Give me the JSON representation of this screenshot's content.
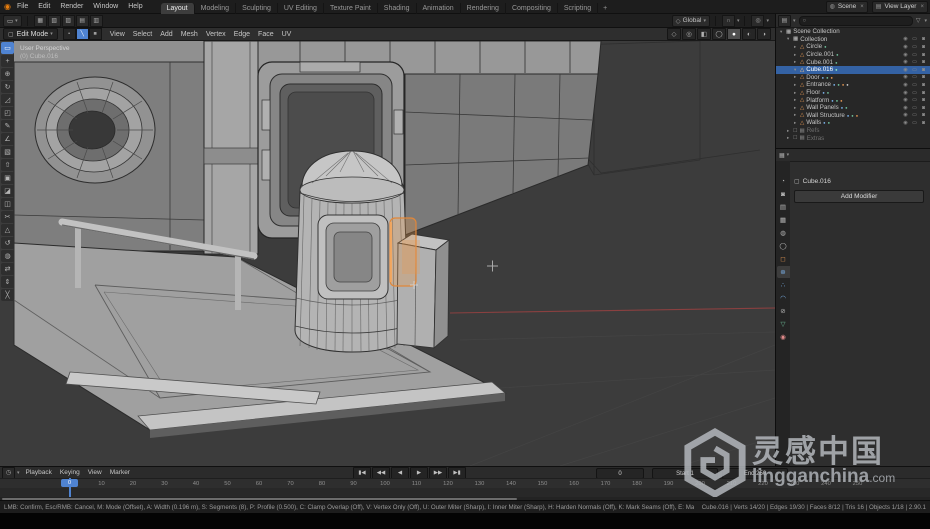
{
  "icons": {
    "dropdown": "▾",
    "close": "×",
    "search": "○",
    "funnel": "▽",
    "magnet": "∩",
    "proportional": "◎",
    "orientation": "◇",
    "eye": "◉",
    "monitor": "▭",
    "camera": "◙",
    "checkbox": "☐",
    "cube": "▢",
    "clock": "◷",
    "active_tool": "▭",
    "editor_outliner": "▤",
    "editor_properties": "▦"
  },
  "topbar": {
    "menus": [
      "File",
      "Edit",
      "Render",
      "Window",
      "Help"
    ],
    "tabs": [
      {
        "label": "Layout",
        "active": true
      },
      {
        "label": "Modeling",
        "active": false
      },
      {
        "label": "Sculpting",
        "active": false
      },
      {
        "label": "UV Editing",
        "active": false
      },
      {
        "label": "Texture Paint",
        "active": false
      },
      {
        "label": "Shading",
        "active": false
      },
      {
        "label": "Animation",
        "active": false
      },
      {
        "label": "Rendering",
        "active": false
      },
      {
        "label": "Compositing",
        "active": false
      },
      {
        "label": "Scripting",
        "active": false
      }
    ],
    "new_tab_label": "+",
    "scene_label": "Scene",
    "view_layer_label": "View Layer"
  },
  "toolrow": {
    "buttons": [
      "▦",
      "▧",
      "▨",
      "▤",
      "▥"
    ],
    "orientation_label": "Global"
  },
  "viewport_header": {
    "mode_label": "Edit Mode",
    "select_modes": [
      {
        "name": "vertex",
        "glyph": "▪",
        "active": false
      },
      {
        "name": "edge",
        "glyph": "╲",
        "active": true
      },
      {
        "name": "face",
        "glyph": "■",
        "active": false
      }
    ],
    "menus": [
      "View",
      "Select",
      "Add",
      "Mesh",
      "Vertex",
      "Edge",
      "Face",
      "UV"
    ],
    "right_icons": [
      {
        "name": "show-gizmos",
        "glyph": "◇",
        "active": false
      },
      {
        "name": "show-overlays",
        "glyph": "◎",
        "active": false
      },
      {
        "name": "toggle-xray",
        "glyph": "◧",
        "active": false
      },
      {
        "name": "shading-wireframe",
        "glyph": "◯",
        "active": false
      },
      {
        "name": "shading-solid",
        "glyph": "●",
        "active": true
      },
      {
        "name": "shading-material",
        "glyph": "◐",
        "active": false
      },
      {
        "name": "shading-rendered",
        "glyph": "◑",
        "active": false
      }
    ]
  },
  "viewport": {
    "overlay_line1": "User Perspective",
    "overlay_line2": "(0) Cube.016",
    "x_axis_color": "#8a4040",
    "selection_highlight_color": "#e0873a"
  },
  "toolbar": {
    "tools": [
      {
        "name": "select-box",
        "glyph": "▭",
        "active": true
      },
      {
        "name": "cursor",
        "glyph": "+",
        "active": false
      },
      {
        "name": "move",
        "glyph": "⊕",
        "active": false
      },
      {
        "name": "rotate",
        "glyph": "↻",
        "active": false
      },
      {
        "name": "scale",
        "glyph": "◿",
        "active": false
      },
      {
        "name": "transform",
        "glyph": "◰",
        "active": false
      },
      {
        "name": "annotate",
        "glyph": "✎",
        "active": false
      },
      {
        "name": "measure",
        "glyph": "∠",
        "active": false
      },
      {
        "name": "add-cube",
        "glyph": "▧",
        "active": false
      },
      {
        "name": "extrude-region",
        "glyph": "⇧",
        "active": false
      },
      {
        "name": "inset-faces",
        "glyph": "▣",
        "active": false
      },
      {
        "name": "bevel",
        "glyph": "◪",
        "active": false
      },
      {
        "name": "loop-cut",
        "glyph": "◫",
        "active": false
      },
      {
        "name": "knife",
        "glyph": "✂",
        "active": false
      },
      {
        "name": "poly-build",
        "glyph": "△",
        "active": false
      },
      {
        "name": "spin",
        "glyph": "↺",
        "active": false
      },
      {
        "name": "smooth",
        "glyph": "◍",
        "active": false
      },
      {
        "name": "edge-slide",
        "glyph": "⇄",
        "active": false
      },
      {
        "name": "shrink-fatten",
        "glyph": "⇕",
        "active": false
      },
      {
        "name": "rip-region",
        "glyph": "╳",
        "active": false
      }
    ]
  },
  "outliner": {
    "search_value": "",
    "items": [
      {
        "label": "Scene Collection",
        "level": 0,
        "arrow": "▾",
        "glyph": "▦",
        "color": "#c9c9c9",
        "icon": "scene-collection",
        "badges": [],
        "toggles": false,
        "selected": false,
        "dim": false,
        "checkbox": false
      },
      {
        "label": "Collection",
        "level": 1,
        "arrow": "▾",
        "glyph": "▦",
        "color": "#c9c9c9",
        "icon": "collection",
        "badges": [],
        "toggles": true,
        "selected": false,
        "dim": false,
        "checkbox": false
      },
      {
        "label": "Circle",
        "level": 2,
        "arrow": "▸",
        "glyph": "△",
        "color": "#e09553",
        "icon": "mesh-object",
        "badges": [
          "#6fbf9a"
        ],
        "toggles": true,
        "selected": false,
        "dim": false,
        "checkbox": false
      },
      {
        "label": "Circle.001",
        "level": 2,
        "arrow": "▸",
        "glyph": "△",
        "color": "#e09553",
        "icon": "mesh-object",
        "badges": [
          "#6fbf9a"
        ],
        "toggles": true,
        "selected": false,
        "dim": false,
        "checkbox": false
      },
      {
        "label": "Cube.001",
        "level": 2,
        "arrow": "▸",
        "glyph": "△",
        "color": "#e09553",
        "icon": "mesh-object",
        "badges": [
          "#6fbf9a"
        ],
        "toggles": true,
        "selected": false,
        "dim": false,
        "checkbox": false
      },
      {
        "label": "Cube.016",
        "level": 2,
        "arrow": "▾",
        "glyph": "△",
        "color": "#ffc98c",
        "icon": "mesh-object",
        "badges": [
          "#8fe8c2"
        ],
        "toggles": true,
        "selected": true,
        "dim": false,
        "checkbox": false
      },
      {
        "label": "Door",
        "level": 2,
        "arrow": "▸",
        "glyph": "△",
        "color": "#e09553",
        "icon": "mesh-object",
        "badges": [
          "#7ab0e8",
          "#6fbf9a",
          "#e09553"
        ],
        "toggles": true,
        "selected": false,
        "dim": false,
        "checkbox": false
      },
      {
        "label": "Entrance",
        "level": 2,
        "arrow": "▸",
        "glyph": "△",
        "color": "#e09553",
        "icon": "mesh-object",
        "badges": [
          "#7ab0e8",
          "#6fbf9a",
          "#e09553",
          "#c9c9c9"
        ],
        "toggles": true,
        "selected": false,
        "dim": false,
        "checkbox": false
      },
      {
        "label": "Floor",
        "level": 2,
        "arrow": "▸",
        "glyph": "△",
        "color": "#e09553",
        "icon": "mesh-object",
        "badges": [
          "#7ab0e8",
          "#6fbf9a"
        ],
        "toggles": true,
        "selected": false,
        "dim": false,
        "checkbox": false
      },
      {
        "label": "Platform",
        "level": 2,
        "arrow": "▸",
        "glyph": "△",
        "color": "#e09553",
        "icon": "mesh-object",
        "badges": [
          "#7ab0e8",
          "#6fbf9a",
          "#e09553"
        ],
        "toggles": true,
        "selected": false,
        "dim": false,
        "checkbox": false
      },
      {
        "label": "Wall Panels",
        "level": 2,
        "arrow": "▸",
        "glyph": "△",
        "color": "#e09553",
        "icon": "mesh-object",
        "badges": [
          "#7ab0e8",
          "#6fbf9a"
        ],
        "toggles": true,
        "selected": false,
        "dim": false,
        "checkbox": false
      },
      {
        "label": "Wall Structure",
        "level": 2,
        "arrow": "▸",
        "glyph": "△",
        "color": "#e09553",
        "icon": "mesh-object",
        "badges": [
          "#7ab0e8",
          "#6fbf9a",
          "#e09553"
        ],
        "toggles": true,
        "selected": false,
        "dim": false,
        "checkbox": false
      },
      {
        "label": "Walls",
        "level": 2,
        "arrow": "▸",
        "glyph": "△",
        "color": "#e09553",
        "icon": "mesh-object",
        "badges": [
          "#7ab0e8",
          "#6fbf9a"
        ],
        "toggles": true,
        "selected": false,
        "dim": false,
        "checkbox": false
      },
      {
        "label": "Refs",
        "level": 1,
        "arrow": "▸",
        "glyph": "▦",
        "color": "#7a7a7a",
        "icon": "collection",
        "badges": [],
        "toggles": false,
        "selected": false,
        "dim": true,
        "checkbox": true
      },
      {
        "label": "Extras",
        "level": 1,
        "arrow": "▸",
        "glyph": "▦",
        "color": "#7a7a7a",
        "icon": "collection",
        "badges": [],
        "toggles": false,
        "selected": false,
        "dim": true,
        "checkbox": true
      }
    ]
  },
  "properties": {
    "tabs": [
      {
        "name": "tool",
        "glyph": "◔",
        "color": "#b8b8b8",
        "active": false
      },
      {
        "name": "render",
        "glyph": "◙",
        "color": "#b8b8b8",
        "active": false
      },
      {
        "name": "output",
        "glyph": "▤",
        "color": "#b8b8b8",
        "active": false
      },
      {
        "name": "view-layer",
        "glyph": "▦",
        "color": "#b8b8b8",
        "active": false
      },
      {
        "name": "scene",
        "glyph": "◍",
        "color": "#b8b8b8",
        "active": false
      },
      {
        "name": "world",
        "glyph": "◯",
        "color": "#b8b8b8",
        "active": false
      },
      {
        "name": "object",
        "glyph": "◻",
        "color": "#e09553",
        "active": false
      },
      {
        "name": "modifiers",
        "glyph": "⊛",
        "color": "#7ab0e8",
        "active": true
      },
      {
        "name": "particles",
        "glyph": "∴",
        "color": "#7ab0e8",
        "active": false
      },
      {
        "name": "physics",
        "glyph": "◠",
        "color": "#7ab0e8",
        "active": false
      },
      {
        "name": "constraints",
        "glyph": "⊘",
        "color": "#b8b8b8",
        "active": false
      },
      {
        "name": "object-data",
        "glyph": "▽",
        "color": "#6fbf9a",
        "active": false
      },
      {
        "name": "material",
        "glyph": "◉",
        "color": "#e08a8a",
        "active": false
      }
    ],
    "breadcrumb": "Cube.016",
    "add_modifier_label": "Add Modifier"
  },
  "timeline": {
    "menus": [
      "Playback",
      "Keying",
      "View",
      "Marker"
    ],
    "playback": [
      {
        "name": "jump-to-start",
        "glyph": "▮◀"
      },
      {
        "name": "prev-keyframe",
        "glyph": "◀◀"
      },
      {
        "name": "play-reverse",
        "glyph": "◀"
      },
      {
        "name": "play",
        "glyph": "▶"
      },
      {
        "name": "next-keyframe",
        "glyph": "▶▶"
      },
      {
        "name": "jump-to-end",
        "glyph": "▶▮"
      }
    ],
    "current_frame": "0",
    "frame_field_value": "0",
    "start_field": "Start 1",
    "end_field": "End 250",
    "ticks": [
      0,
      10,
      20,
      30,
      40,
      50,
      60,
      70,
      80,
      90,
      100,
      110,
      120,
      130,
      140,
      150,
      160,
      170,
      180,
      190,
      200,
      210,
      220,
      230,
      240,
      250
    ]
  },
  "statusbar": {
    "left": "LMB: Confirm, Esc/RMB: Cancel, M: Mode (Offset), A: Width (0.196 m), S: Segments (8), P: Profile (0.500), C: Clamp Overlap (Off), V: Vertex Only (Off), U: Outer Miter (Sharp), I: Inner Miter (Sharp), H: Harden Normals (Off), K: Mark Seams (Off), E: Mark Sharp (Off), Z: Profile Type (Superellipse), G: Intersection (Grid Fill)",
    "right": "Cube.016 | Verts 14/20 | Edges 19/30 | Faces 8/12 | Tris 16 | Objects 1/18 | 2.90.1"
  },
  "watermark": {
    "title": "灵感中国",
    "domain": "lingganchina",
    "tld": ".com"
  }
}
